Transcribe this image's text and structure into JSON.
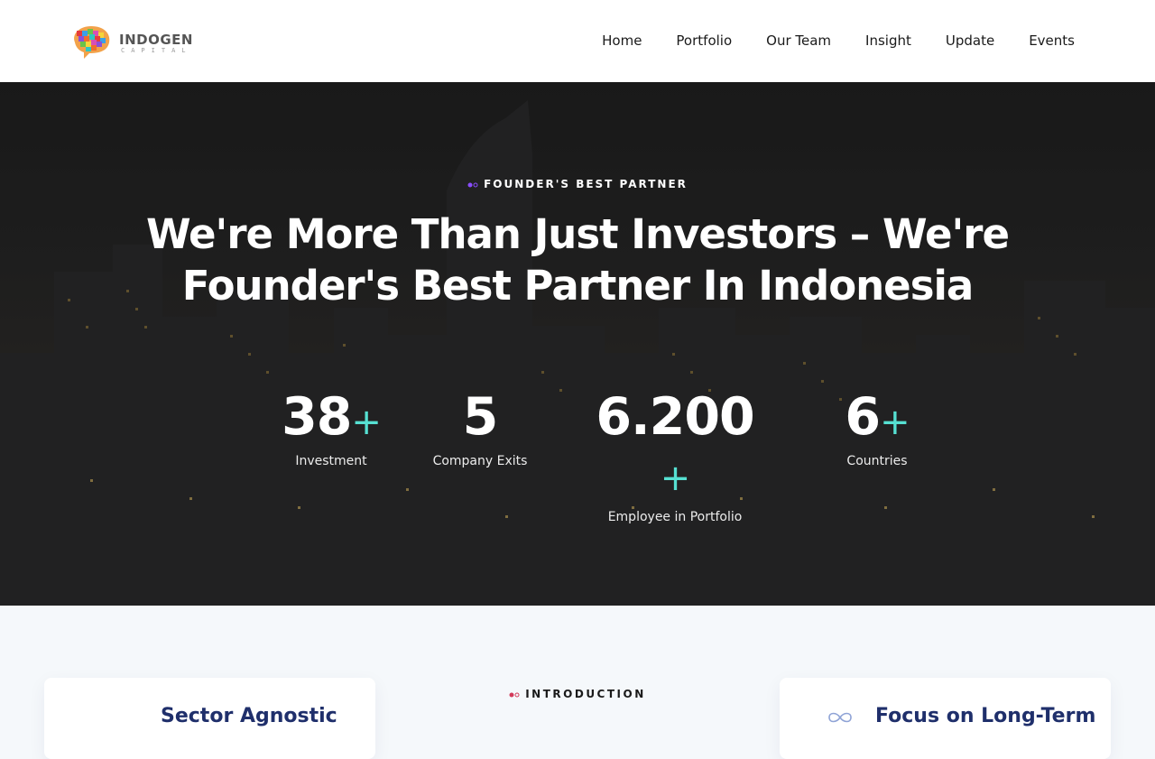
{
  "logo": {
    "title": "INDOGEN",
    "subtitle": "CAPITAL"
  },
  "nav": {
    "items": [
      "Home",
      "Portfolio",
      "Our Team",
      "Insight",
      "Update",
      "Events"
    ]
  },
  "hero": {
    "eyebrow": "FOUNDER'S BEST PARTNER",
    "title_line1": "We're More Than Just Investors – We're",
    "title_line2": "Founder's Best Partner In Indonesia"
  },
  "stats": [
    {
      "value": "38",
      "suffix": "+",
      "label": "Investment"
    },
    {
      "value": "5",
      "suffix": "",
      "label": "Company Exits"
    },
    {
      "value": "6.200",
      "suffix": "+",
      "label": "Employee in Portfolio"
    },
    {
      "value": "6",
      "suffix": "+",
      "label": "Countries"
    }
  ],
  "intro": {
    "label": "INTRODUCTION",
    "card_left_title": "Sector Agnostic",
    "card_right_title": "Focus on Long-Term"
  },
  "colors": {
    "accent_teal": "#56e0d2",
    "accent_purple": "#8a4dff",
    "card_title": "#1f2f6b"
  },
  "icons": {
    "infinity": "infinity-icon"
  }
}
